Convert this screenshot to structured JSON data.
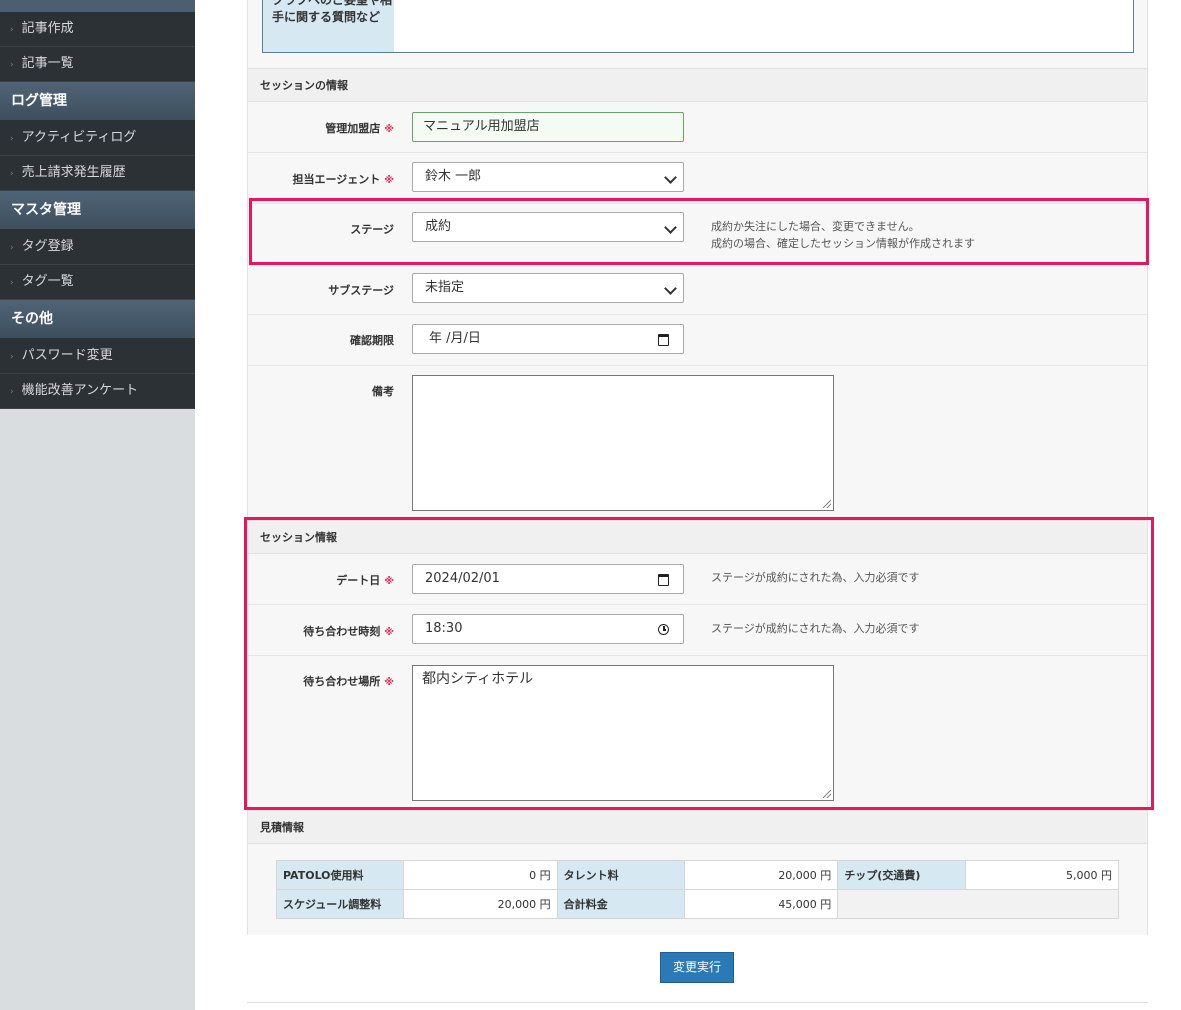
{
  "sidebar": {
    "items_top": [
      "記事作成",
      "記事一覧"
    ],
    "log_heading": "ログ管理",
    "log_items": [
      "アクティビティログ",
      "売上請求発生履歴"
    ],
    "master_heading": "マスタ管理",
    "master_items": [
      "タグ登録",
      "タグ一覧"
    ],
    "other_heading": "その他",
    "other_items": [
      "パスワード変更",
      "機能改善アンケート"
    ]
  },
  "previous_field": {
    "label": "クラブへのご要望や相手に関する質問など"
  },
  "session_info_section": {
    "heading": "セッションの情報",
    "required_mark": "※",
    "store": {
      "label": "管理加盟店",
      "value": "マニュアル用加盟店"
    },
    "agent": {
      "label": "担当エージェント",
      "value": "鈴木 一郎"
    },
    "stage": {
      "label": "ステージ",
      "value": "成約",
      "hint_line1": "成約か失注にした場合、変更できません。",
      "hint_line2": "成約の場合、確定したセッション情報が作成されます"
    },
    "substage": {
      "label": "サブステージ",
      "value": "未指定"
    },
    "deadline": {
      "label": "確認期限",
      "value": "年 /月/日"
    },
    "note": {
      "label": "備考",
      "value": ""
    }
  },
  "session_detail_section": {
    "heading": "セッション情報",
    "date": {
      "label": "デート日",
      "value": "2024/02/01",
      "hint": "ステージが成約にされた為、入力必須です"
    },
    "time": {
      "label": "待ち合わせ時刻",
      "value": "18:30",
      "hint": "ステージが成約にされた為、入力必須です"
    },
    "place": {
      "label": "待ち合わせ場所",
      "value": "都内シティホテル"
    }
  },
  "estimate_section": {
    "heading": "見積情報",
    "rows": [
      [
        {
          "label": "PATOLO使用料",
          "value": "0 円"
        },
        {
          "label": "タレント料",
          "value": "20,000 円"
        },
        {
          "label": "チップ(交通費)",
          "value": "5,000 円"
        }
      ],
      [
        {
          "label": "スケジュール調整料",
          "value": "20,000 円"
        },
        {
          "label": "合計料金",
          "value": "45,000 円"
        }
      ]
    ]
  },
  "submit_label": "変更実行",
  "colors": {
    "sidebar_dark": "#2c3136",
    "sidebar_heading": "#4f6477",
    "highlight": "#e8175d",
    "button": "#2b79b6",
    "label_bg": "#d6e9f3"
  }
}
